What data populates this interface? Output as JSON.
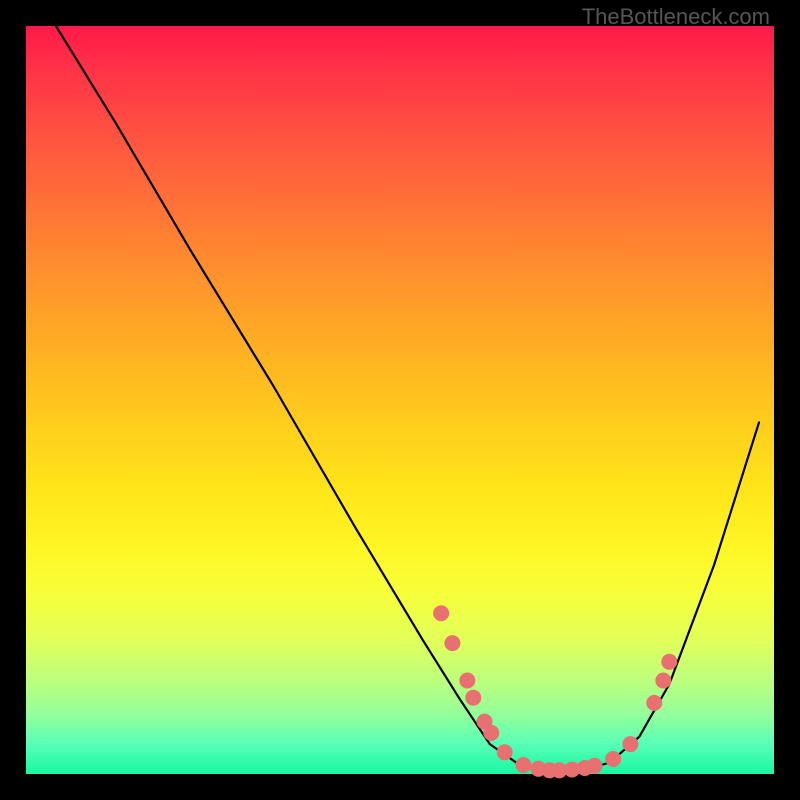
{
  "attribution": "TheBottleneck.com",
  "chart_data": {
    "type": "line",
    "title": "",
    "xlabel": "",
    "ylabel": "",
    "xlim": [
      0,
      100
    ],
    "ylim": [
      0,
      100
    ],
    "curve": [
      {
        "x": 4,
        "y": 100
      },
      {
        "x": 12,
        "y": 87
      },
      {
        "x": 22,
        "y": 70
      },
      {
        "x": 33,
        "y": 52
      },
      {
        "x": 44,
        "y": 33
      },
      {
        "x": 53,
        "y": 18
      },
      {
        "x": 58,
        "y": 10
      },
      {
        "x": 62,
        "y": 4
      },
      {
        "x": 66,
        "y": 1.2
      },
      {
        "x": 70,
        "y": 0.5
      },
      {
        "x": 74,
        "y": 0.5
      },
      {
        "x": 78,
        "y": 1.5
      },
      {
        "x": 82,
        "y": 5
      },
      {
        "x": 86,
        "y": 12
      },
      {
        "x": 92,
        "y": 28
      },
      {
        "x": 98,
        "y": 47
      }
    ],
    "points": [
      {
        "x": 55.5,
        "y": 21.5
      },
      {
        "x": 57.0,
        "y": 17.5
      },
      {
        "x": 59.0,
        "y": 12.5
      },
      {
        "x": 59.8,
        "y": 10.2
      },
      {
        "x": 61.3,
        "y": 7.0
      },
      {
        "x": 62.2,
        "y": 5.5
      },
      {
        "x": 64.0,
        "y": 2.9
      },
      {
        "x": 66.5,
        "y": 1.2
      },
      {
        "x": 68.5,
        "y": 0.7
      },
      {
        "x": 70.0,
        "y": 0.5
      },
      {
        "x": 71.3,
        "y": 0.5
      },
      {
        "x": 73.0,
        "y": 0.6
      },
      {
        "x": 74.7,
        "y": 0.8
      },
      {
        "x": 76.0,
        "y": 1.1
      },
      {
        "x": 78.5,
        "y": 2.0
      },
      {
        "x": 80.8,
        "y": 4.0
      },
      {
        "x": 84.0,
        "y": 9.5
      },
      {
        "x": 85.2,
        "y": 12.5
      },
      {
        "x": 86.0,
        "y": 15.0
      }
    ],
    "point_color": "#e87070",
    "curve_color": "#000000"
  }
}
